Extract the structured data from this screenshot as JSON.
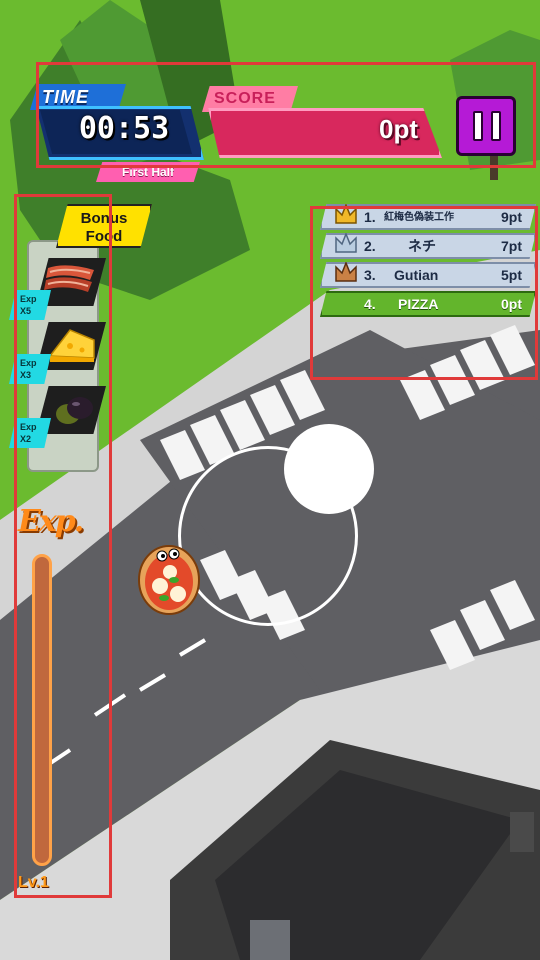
{
  "hud": {
    "time_label": "TIME",
    "time_value": "00:53",
    "half_label": "First Half",
    "score_label": "SCORE",
    "score_value": "0pt"
  },
  "leaderboard": [
    {
      "rank": "1.",
      "name": "紅梅色偽装工作",
      "score": "9pt",
      "crown": "gold",
      "me": false
    },
    {
      "rank": "2.",
      "name": "ネチ",
      "score": "7pt",
      "crown": "silver",
      "me": false
    },
    {
      "rank": "3.",
      "name": "Gutian",
      "score": "5pt",
      "crown": "bronze",
      "me": false
    },
    {
      "rank": "4.",
      "name": "PIZZA",
      "score": "0pt",
      "crown": "",
      "me": true
    }
  ],
  "bonus": {
    "title_line1": "Bonus",
    "title_line2": "Food",
    "items": [
      {
        "food": "bacon-icon",
        "exp_line1": "Exp",
        "exp_line2": "X5"
      },
      {
        "food": "cheese-icon",
        "exp_line1": "Exp",
        "exp_line2": "X3"
      },
      {
        "food": "olive-icon",
        "exp_line1": "Exp",
        "exp_line2": "X2"
      }
    ]
  },
  "exp": {
    "label": "Exp.",
    "level": "Lv.1",
    "progress": 0.0
  },
  "player": {
    "character": "pizza-icon"
  },
  "colors": {
    "grass": "#6bbb2f",
    "road": "#5f5f63",
    "sidewalk": "#cfcfcf",
    "time_blue": "#1e6fd8",
    "score_pink": "#d8285d",
    "pause_purple": "#b51ad6",
    "frame_red": "#e03a3a"
  }
}
